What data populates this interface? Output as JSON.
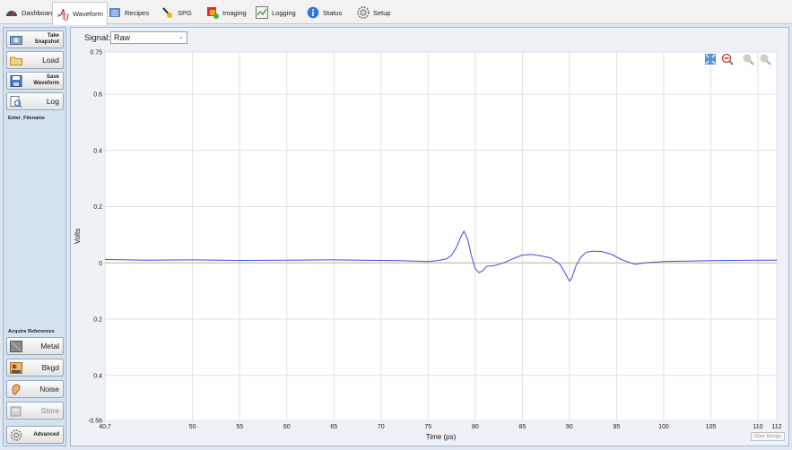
{
  "nav": {
    "tabs": [
      {
        "label": "Dashboard",
        "icon": "gauge-icon",
        "active": false
      },
      {
        "label": "Waveform",
        "icon": "waveform-icon",
        "active": true
      },
      {
        "label": "Recipes",
        "icon": "list-icon",
        "active": false
      },
      {
        "label": "SPG",
        "icon": "spg-icon",
        "active": false
      },
      {
        "label": "Imaging",
        "icon": "imaging-icon",
        "active": false
      },
      {
        "label": "Logging",
        "icon": "logging-icon",
        "active": false
      },
      {
        "label": "Status",
        "icon": "info-icon",
        "active": false
      },
      {
        "label": "Setup",
        "icon": "gear-icon",
        "active": false
      }
    ]
  },
  "sidebar": {
    "take_snapshot": "Take\nSnapshot",
    "load": "Load",
    "save_waveform": "Save\nWaveform",
    "log": "Log",
    "filename_label": "Enter_Filename",
    "acquire_label": "Acquire References",
    "metal": "Metal",
    "bkgd": "Bkgd",
    "noise": "Noise",
    "store": "Store",
    "advanced": "Advanced"
  },
  "main": {
    "signal_label": "Signal:",
    "signal_value": "Raw",
    "over_range": "Over Range"
  },
  "chart_data": {
    "type": "line",
    "xlabel": "Time (ps)",
    "ylabel": "Volts",
    "xlim": [
      40.7,
      112
    ],
    "ylim": [
      -0.56,
      0.75
    ],
    "x_ticks": [
      {
        "v": 40.7,
        "t": "40.7"
      },
      {
        "v": 50,
        "t": "50"
      },
      {
        "v": 55,
        "t": "55"
      },
      {
        "v": 60,
        "t": "60"
      },
      {
        "v": 65,
        "t": "65"
      },
      {
        "v": 70,
        "t": "70"
      },
      {
        "v": 75,
        "t": "75"
      },
      {
        "v": 80,
        "t": "80"
      },
      {
        "v": 85,
        "t": "85"
      },
      {
        "v": 90,
        "t": "90"
      },
      {
        "v": 95,
        "t": "95"
      },
      {
        "v": 100,
        "t": "100"
      },
      {
        "v": 105,
        "t": "105"
      },
      {
        "v": 110,
        "t": "110"
      },
      {
        "v": 112,
        "t": "112"
      }
    ],
    "y_ticks": [
      {
        "v": 0.75,
        "t": "0.75"
      },
      {
        "v": 0.6,
        "t": "0.6"
      },
      {
        "v": 0.4,
        "t": "0.4"
      },
      {
        "v": 0.2,
        "t": "0.2"
      },
      {
        "v": 0,
        "t": "0"
      },
      {
        "v": -0.2,
        "t": "0.2"
      },
      {
        "v": -0.4,
        "t": "0.4"
      },
      {
        "v": -0.56,
        "t": "-0.56"
      }
    ],
    "grid": true,
    "colors": {
      "signal": "#3f4fd6",
      "baseline": "#c9b98a",
      "grid": "#e0e0e0"
    },
    "series": [
      {
        "x": [
          40.7,
          45,
          50,
          55,
          60,
          65,
          70,
          72,
          75,
          76,
          77,
          77.5,
          78,
          78.5,
          78.8,
          79.2,
          79.6,
          80.0,
          80.4,
          80.8,
          81.2,
          82,
          83,
          84,
          85,
          86,
          87,
          88,
          89,
          89.6,
          90.0,
          90.3,
          90.7,
          91.2,
          91.8,
          92.5,
          93.5,
          94.5,
          95.5,
          96.5,
          97,
          98,
          100,
          105,
          110,
          112
        ],
        "y": [
          0.012,
          0.01,
          0.011,
          0.009,
          0.01,
          0.011,
          0.009,
          0.008,
          0.005,
          0.008,
          0.015,
          0.028,
          0.055,
          0.095,
          0.113,
          0.085,
          0.025,
          -0.02,
          -0.035,
          -0.028,
          -0.012,
          -0.01,
          0.0,
          0.015,
          0.028,
          0.03,
          0.025,
          0.018,
          -0.005,
          -0.04,
          -0.065,
          -0.05,
          -0.01,
          0.02,
          0.038,
          0.042,
          0.04,
          0.03,
          0.012,
          0.0,
          -0.005,
          0.0,
          0.005,
          0.008,
          0.01,
          0.01
        ]
      }
    ]
  }
}
